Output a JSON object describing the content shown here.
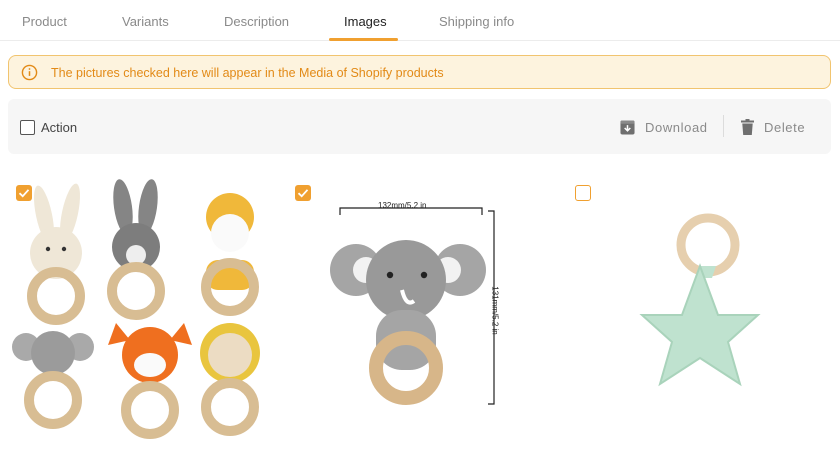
{
  "tabs": [
    {
      "label": "Product"
    },
    {
      "label": "Variants"
    },
    {
      "label": "Description"
    },
    {
      "label": "Images"
    },
    {
      "label": "Shipping info"
    }
  ],
  "active_tab": "Images",
  "notice": {
    "text": "The pictures checked here will appear in the Media of Shopify products"
  },
  "toolbar": {
    "action_label": "Action",
    "download_label": "Download",
    "delete_label": "Delete"
  },
  "images": [
    {
      "checked": true
    },
    {
      "checked": true,
      "width_label": "132mm/5.2 in",
      "height_label": "131mm/5.2 in"
    },
    {
      "checked": false
    }
  ],
  "colors": {
    "accent": "#f0a030",
    "notice_bg": "#fdf3de",
    "notice_text": "#e28a17"
  }
}
